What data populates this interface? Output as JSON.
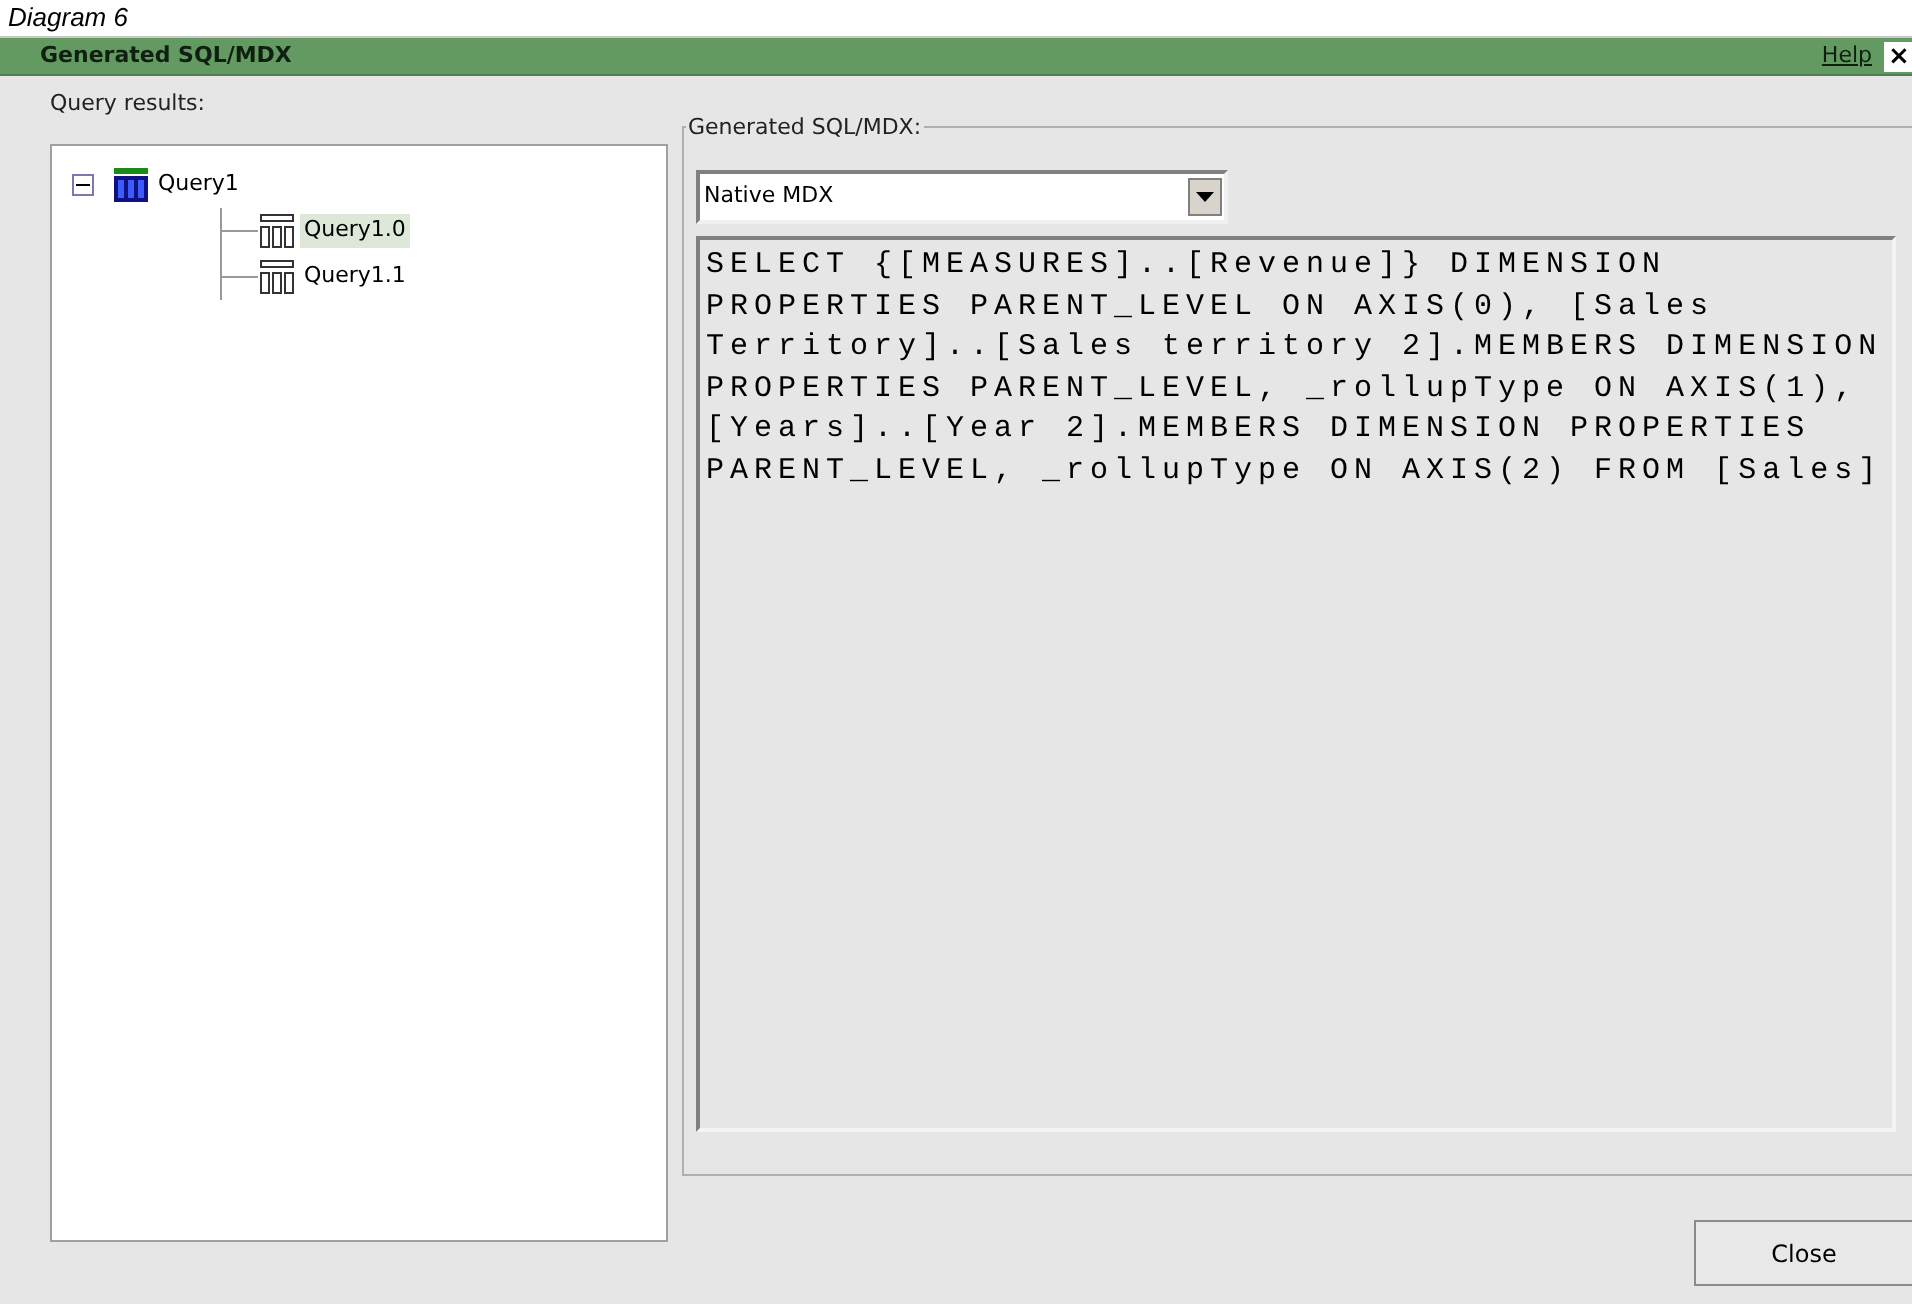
{
  "caption": "Diagram 6",
  "window": {
    "title": "Generated SQL/MDX",
    "help": "Help",
    "close_glyph": "×"
  },
  "tree": {
    "label": "Query results:",
    "items": [
      {
        "label": "Query1",
        "kind": "query",
        "expanded": true,
        "selected": false,
        "children": [
          {
            "label": "Query1.0",
            "kind": "result",
            "selected": true
          },
          {
            "label": "Query1.1",
            "kind": "result",
            "selected": false
          }
        ]
      }
    ]
  },
  "sql_group": {
    "legend": "Generated SQL/MDX:",
    "dropdown": {
      "value": "Native MDX"
    },
    "code": "SELECT {[MEASURES]..[Revenue]} DIMENSION PROPERTIES PARENT_LEVEL ON AXIS(0), [Sales Territory]..[Sales territory 2].MEMBERS DIMENSION PROPERTIES PARENT_LEVEL, _rollupType ON AXIS(1), [Years]..[Year 2].MEMBERS DIMENSION PROPERTIES PARENT_LEVEL, _rollupType ON AXIS(2) FROM [Sales]"
  },
  "buttons": [
    "Close"
  ]
}
